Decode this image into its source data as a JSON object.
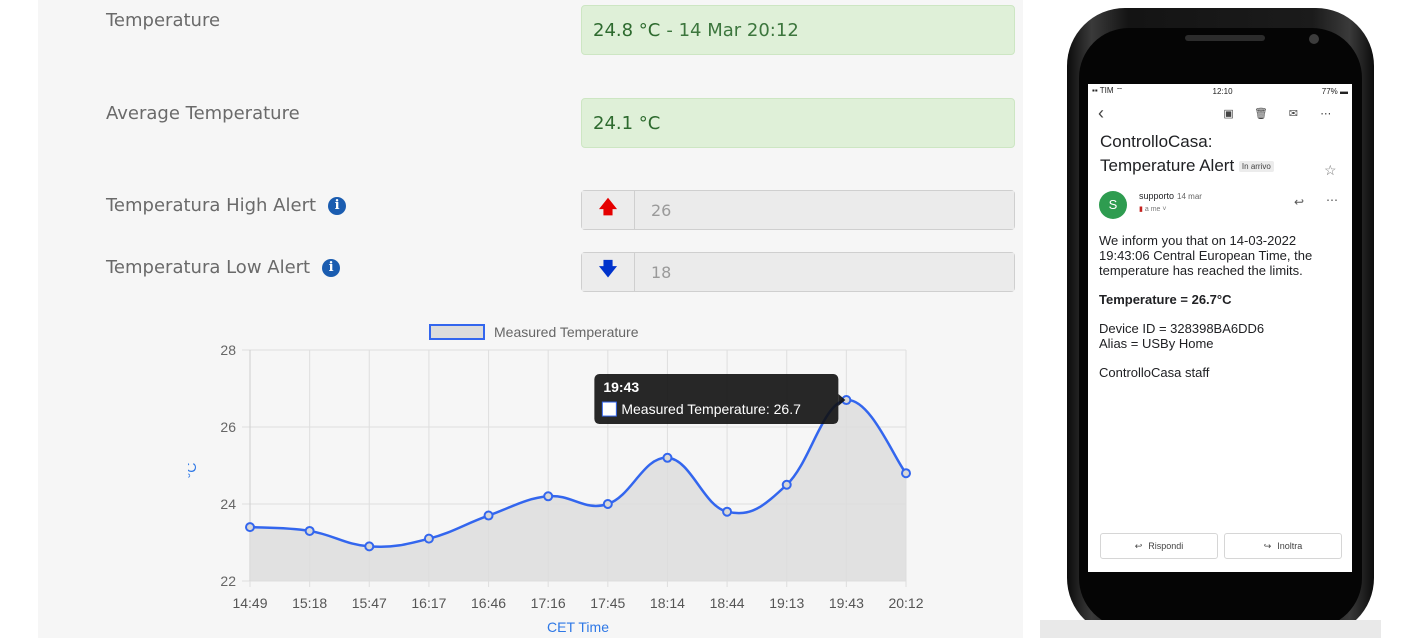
{
  "dashboard": {
    "temperature": {
      "label": "Temperature",
      "value": "24.8 °C",
      "time": "- 14 Mar 20:12"
    },
    "average": {
      "label": "Average Temperature",
      "value": "24.1 °C"
    },
    "high_alert": {
      "label": "Temperatura High Alert",
      "value": "26",
      "icon": "arrow-up-icon",
      "color": "#e50000"
    },
    "low_alert": {
      "label": "Temperatura Low Alert",
      "value": "18",
      "icon": "arrow-down-icon",
      "color": "#0033cc"
    },
    "info_icon": "info-icon"
  },
  "chart_data": {
    "type": "line",
    "legend": "Measured Temperature",
    "categories": [
      "14:49",
      "15:18",
      "15:47",
      "16:17",
      "16:46",
      "17:16",
      "17:45",
      "18:14",
      "18:44",
      "19:13",
      "19:43",
      "20:12"
    ],
    "series": [
      {
        "name": "Measured Temperature",
        "values": [
          23.4,
          23.3,
          22.9,
          23.1,
          23.7,
          24.2,
          24.0,
          25.2,
          23.8,
          24.5,
          26.7,
          24.8
        ]
      }
    ],
    "xlabel": "CET Time",
    "ylabel": "°C",
    "ylim": [
      22,
      28
    ],
    "yticks": [
      22,
      24,
      26,
      28
    ],
    "grid": true,
    "legend_position": "top",
    "tooltip": {
      "title": "19:43",
      "text": "Measured Temperature: 26.7"
    },
    "colors": {
      "line": "#3366ee",
      "fill": "#dcdcdc"
    }
  },
  "phone": {
    "status": {
      "carrier": "TIM",
      "time": "12:10",
      "battery": "77%"
    },
    "subject": "ControlloCasa: Temperature Alert",
    "tag": "In arrivo",
    "sender": {
      "initial": "S",
      "name": "supporto",
      "date": "14 mar",
      "to": "a me"
    },
    "body": {
      "p1": "We inform you that on 14-03-2022 19:43:06 Central European Time, the temperature has reached the limits.",
      "p2": "Temperature = 26.7°C",
      "p3a": "Device ID = 328398BA6DD6",
      "p3b": "Alias = USBy Home",
      "p4": "ControlloCasa staff"
    },
    "actions": {
      "reply": "Rispondi",
      "forward": "Inoltra"
    }
  }
}
